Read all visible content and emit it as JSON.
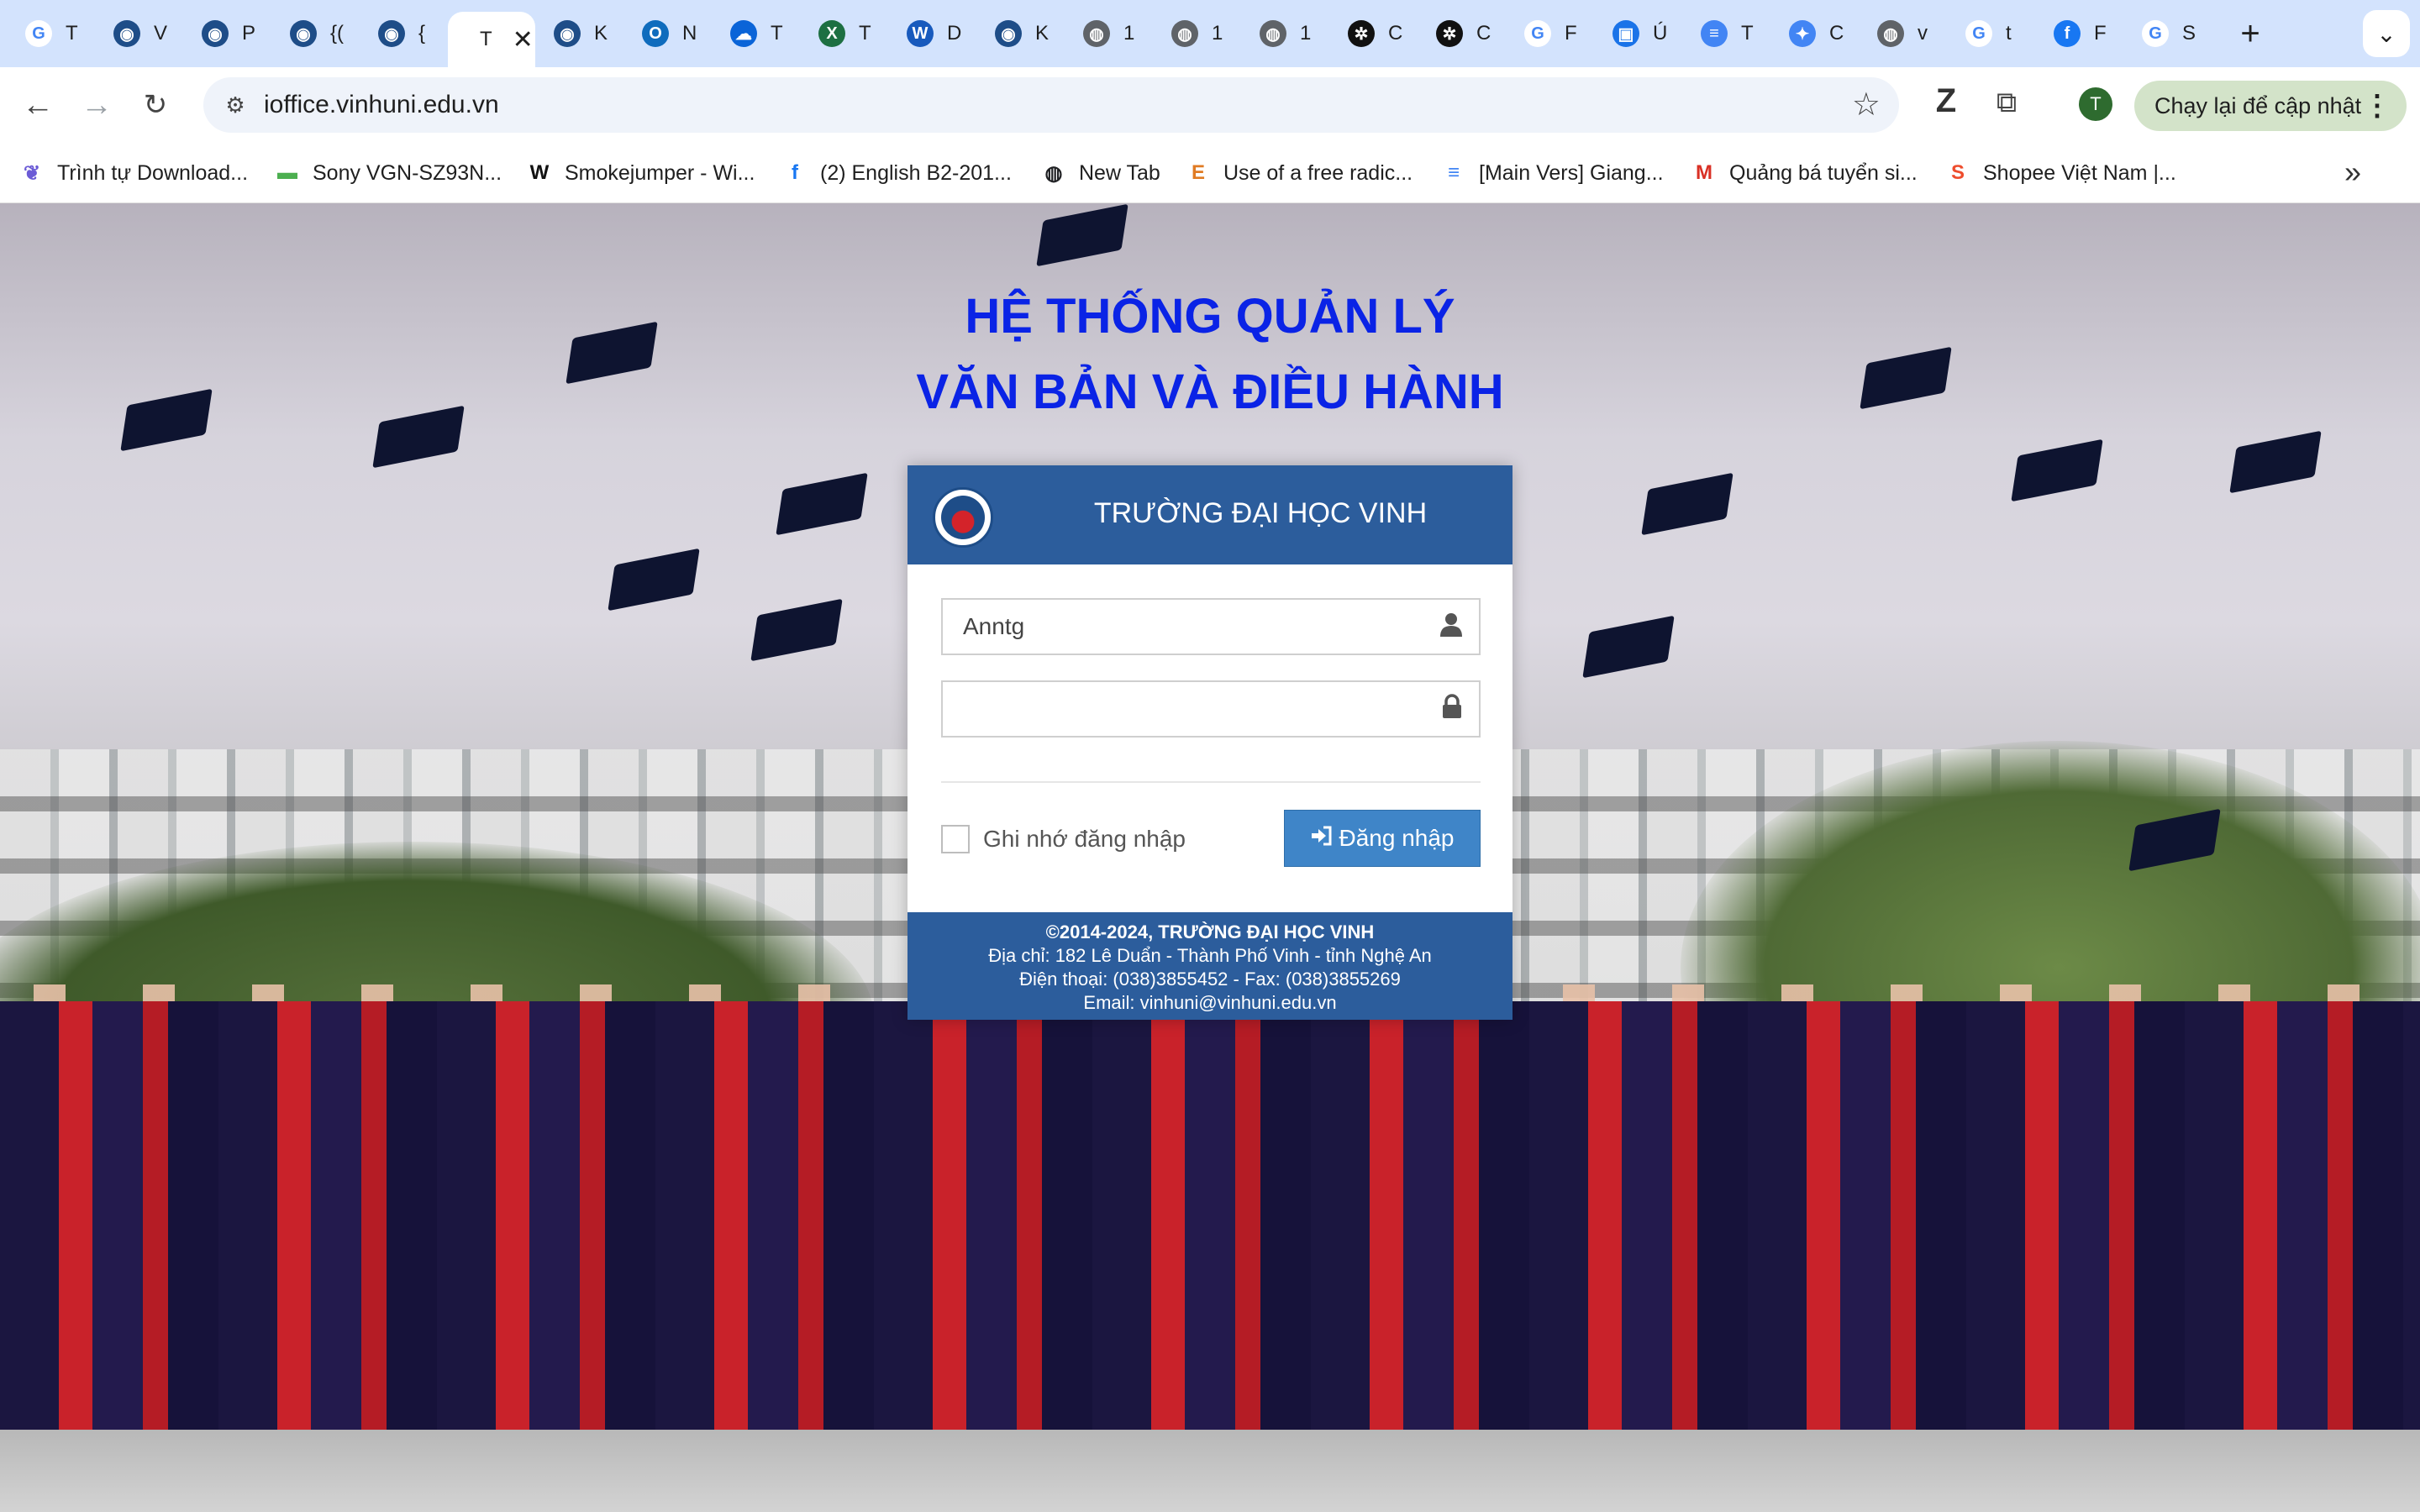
{
  "browser": {
    "tabs": [
      {
        "title": "T",
        "icon": "google-icon",
        "color": "#4285f4"
      },
      {
        "title": "V",
        "icon": "vinhuni-icon",
        "color": "#1e4d88"
      },
      {
        "title": "P",
        "icon": "vinhuni-icon",
        "color": "#1e4d88"
      },
      {
        "title": "{(",
        "icon": "vinhuni-icon",
        "color": "#1e4d88"
      },
      {
        "title": "{",
        "icon": "vinhuni-icon",
        "color": "#1e4d88"
      },
      {
        "title": "T",
        "icon": "none",
        "color": "#ffffff",
        "active": true
      },
      {
        "title": "K",
        "icon": "vinhuni-icon",
        "color": "#1e4d88"
      },
      {
        "title": "N",
        "icon": "outlook-icon",
        "color": "#0f6cbd"
      },
      {
        "title": "T",
        "icon": "onedrive-icon",
        "color": "#0a64d8"
      },
      {
        "title": "T",
        "icon": "excel-icon",
        "color": "#1d6f42"
      },
      {
        "title": "D",
        "icon": "word-icon",
        "color": "#185abd"
      },
      {
        "title": "K",
        "icon": "vinhuni-icon",
        "color": "#1e4d88"
      },
      {
        "title": "1",
        "icon": "globe-icon",
        "color": "#5f6368"
      },
      {
        "title": "1",
        "icon": "globe-icon",
        "color": "#5f6368"
      },
      {
        "title": "1",
        "icon": "globe-icon",
        "color": "#5f6368"
      },
      {
        "title": "C",
        "icon": "chatgpt-icon",
        "color": "#111111"
      },
      {
        "title": "C",
        "icon": "chatgpt-icon",
        "color": "#111111"
      },
      {
        "title": "F",
        "icon": "google-icon",
        "color": "#4285f4"
      },
      {
        "title": "Ú",
        "icon": "contacts-icon",
        "color": "#1a73e8"
      },
      {
        "title": "T",
        "icon": "docs-icon",
        "color": "#4285f4"
      },
      {
        "title": "C",
        "icon": "gemini-icon",
        "color": "#4285f4"
      },
      {
        "title": "v",
        "icon": "globe-icon",
        "color": "#5f6368"
      },
      {
        "title": "t",
        "icon": "google-icon",
        "color": "#4285f4"
      },
      {
        "title": "F",
        "icon": "facebook-icon",
        "color": "#1877f2"
      },
      {
        "title": "S",
        "icon": "google-icon",
        "color": "#4285f4"
      }
    ],
    "new_tab": "+",
    "tab_search": "⌄",
    "url": "ioffice.vinhuni.edu.vn",
    "profile_initial": "T",
    "update_label": "Chạy lại để cập nhật",
    "bookmarks": [
      {
        "label": "Trình tự Download...",
        "icon": "bird-icon",
        "color": "#6b5bd6"
      },
      {
        "label": "Sony VGN-SZ93N...",
        "icon": "image-icon",
        "color": "#4caf50"
      },
      {
        "label": "Smokejumper - Wi...",
        "icon": "wikipedia-icon",
        "color": "#111111"
      },
      {
        "label": "(2) English B2-201...",
        "icon": "facebook-icon",
        "color": "#1877f2"
      },
      {
        "label": "New Tab",
        "icon": "globe-dark-icon",
        "color": "#202124"
      },
      {
        "label": "Use of a free radic...",
        "icon": "e-icon",
        "color": "#e07b23"
      },
      {
        "label": "[Main Vers] Giang...",
        "icon": "docs-icon",
        "color": "#4285f4"
      },
      {
        "label": "Quảng bá tuyển si...",
        "icon": "gmail-icon",
        "color": "#d93025"
      },
      {
        "label": "Shopee Việt Nam |...",
        "icon": "shopee-icon",
        "color": "#ee4d2d"
      }
    ],
    "bookmarks_more": "»"
  },
  "page": {
    "title_line1": "HỆ THỐNG QUẢN LÝ",
    "title_line2": "VĂN BẢN VÀ ĐIỀU HÀNH",
    "title_color": "#0a23e6",
    "card": {
      "school": "TRƯỜNG ĐẠI HỌC VINH",
      "username_value": "Anntg",
      "password_value": "",
      "remember_label": "Ghi nhớ đăng nhập",
      "remember_checked": false,
      "login_label": "Đăng nhập",
      "header_color": "#2c5d9c",
      "button_color": "#3f85c8"
    },
    "footer": {
      "copyright": "©2014-2024, TRƯỜNG ĐẠI HỌC VINH",
      "address": "Địa chỉ: 182 Lê Duẩn - Thành Phố Vinh - tỉnh Nghệ An",
      "phone": "Điện thoại: (038)3855452 - Fax: (038)3855269",
      "email": "Email: vinhuni@vinhuni.edu.vn"
    }
  }
}
